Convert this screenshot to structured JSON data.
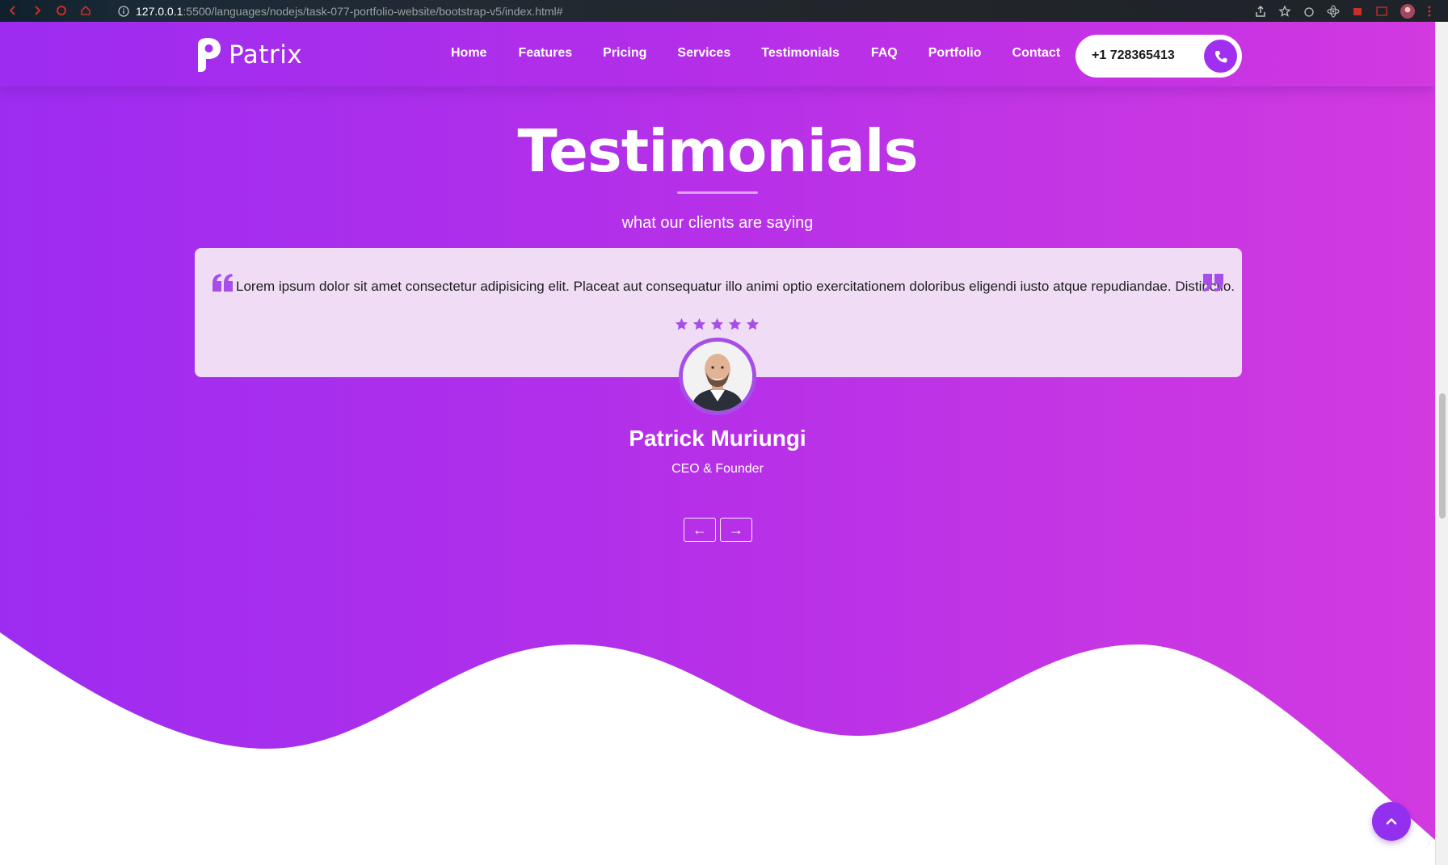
{
  "browser": {
    "url_host": "127.0.0.1",
    "url_path": ":5500/languages/nodejs/task-077-portfolio-website/bootstrap-v5/index.html#"
  },
  "header": {
    "logo_text": "Patrix",
    "nav": [
      "Home",
      "Features",
      "Pricing",
      "Services",
      "Testimonials",
      "FAQ",
      "Portfolio",
      "Contact"
    ],
    "phone": "+1 728365413"
  },
  "section": {
    "title": "Testimonials",
    "subtitle": "what our clients are saying"
  },
  "testimonial": {
    "quote": "Lorem ipsum dolor sit amet consectetur adipisicing elit. Placeat aut consequatur illo animi optio exercitationem doloribus eligendi iusto atque repudiandae. Distinctio.",
    "rating": 5,
    "name": "Patrick Muriungi",
    "role": "CEO & Founder"
  },
  "controls": {
    "prev": "←",
    "next": "→"
  },
  "colors": {
    "brand_purple": "#a02ff0",
    "brand_magenta": "#d23ae0",
    "card_bg": "#f0dcf5",
    "star": "#a64fe8"
  }
}
